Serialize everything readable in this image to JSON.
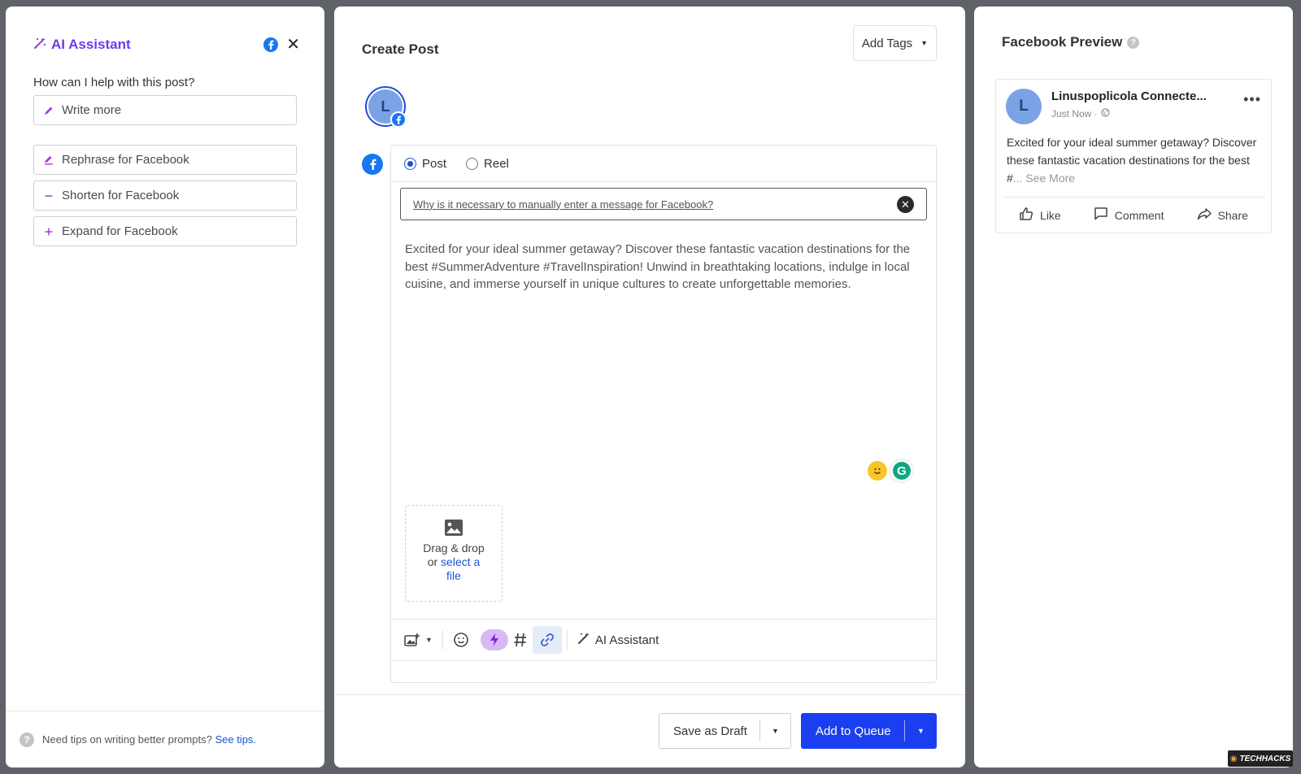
{
  "ai_panel": {
    "title": "AI Assistant",
    "question": "How can I help with this post?",
    "options": [
      {
        "label": "Write more",
        "icon": "pencil-icon"
      },
      {
        "label": "Rephrase for Facebook",
        "icon": "rephrase-icon"
      },
      {
        "label": "Shorten for Facebook",
        "icon": "minus-icon"
      },
      {
        "label": "Expand for Facebook",
        "icon": "plus-icon"
      }
    ],
    "footer_text": "Need tips on writing better prompts?",
    "footer_link": "See tips."
  },
  "create_post": {
    "title": "Create Post",
    "add_tags": "Add Tags",
    "avatar_letter": "L",
    "post_types": [
      {
        "label": "Post",
        "selected": true
      },
      {
        "label": "Reel",
        "selected": false
      }
    ],
    "notice": "Why is it necessary to manually enter a message for Facebook?",
    "post_text": "Excited for your ideal summer getaway? Discover these fantastic vacation destinations for the best #SummerAdventure #TravelInspiration! Unwind in breathtaking locations, indulge in local cuisine, and immerse yourself in unique cultures to create unforgettable memories.",
    "grammarly_letter": "G",
    "drop_zone": {
      "line1": "Drag & drop",
      "or": "or",
      "link1": "select a",
      "link2": "file"
    },
    "toolbar_ai_label": "AI Assistant",
    "save_draft": "Save as Draft",
    "add_to_queue": "Add to Queue"
  },
  "preview": {
    "title": "Facebook Preview",
    "avatar_letter": "L",
    "page_name": "Linuspoplicola Connecte...",
    "time": "Just Now ·",
    "text_before": "Excited for your ideal summer getaway? Discover these fantastic vacation destinations for the best #",
    "see_more": "... See More",
    "like": "Like",
    "comment": "Comment",
    "share": "Share"
  },
  "watermark": "TECHHACKS",
  "colors": {
    "accent_blue": "#1b3ff0",
    "facebook_blue": "#1877f2",
    "ai_purple": "#6a3de8",
    "grammarly_green": "#11a683"
  }
}
